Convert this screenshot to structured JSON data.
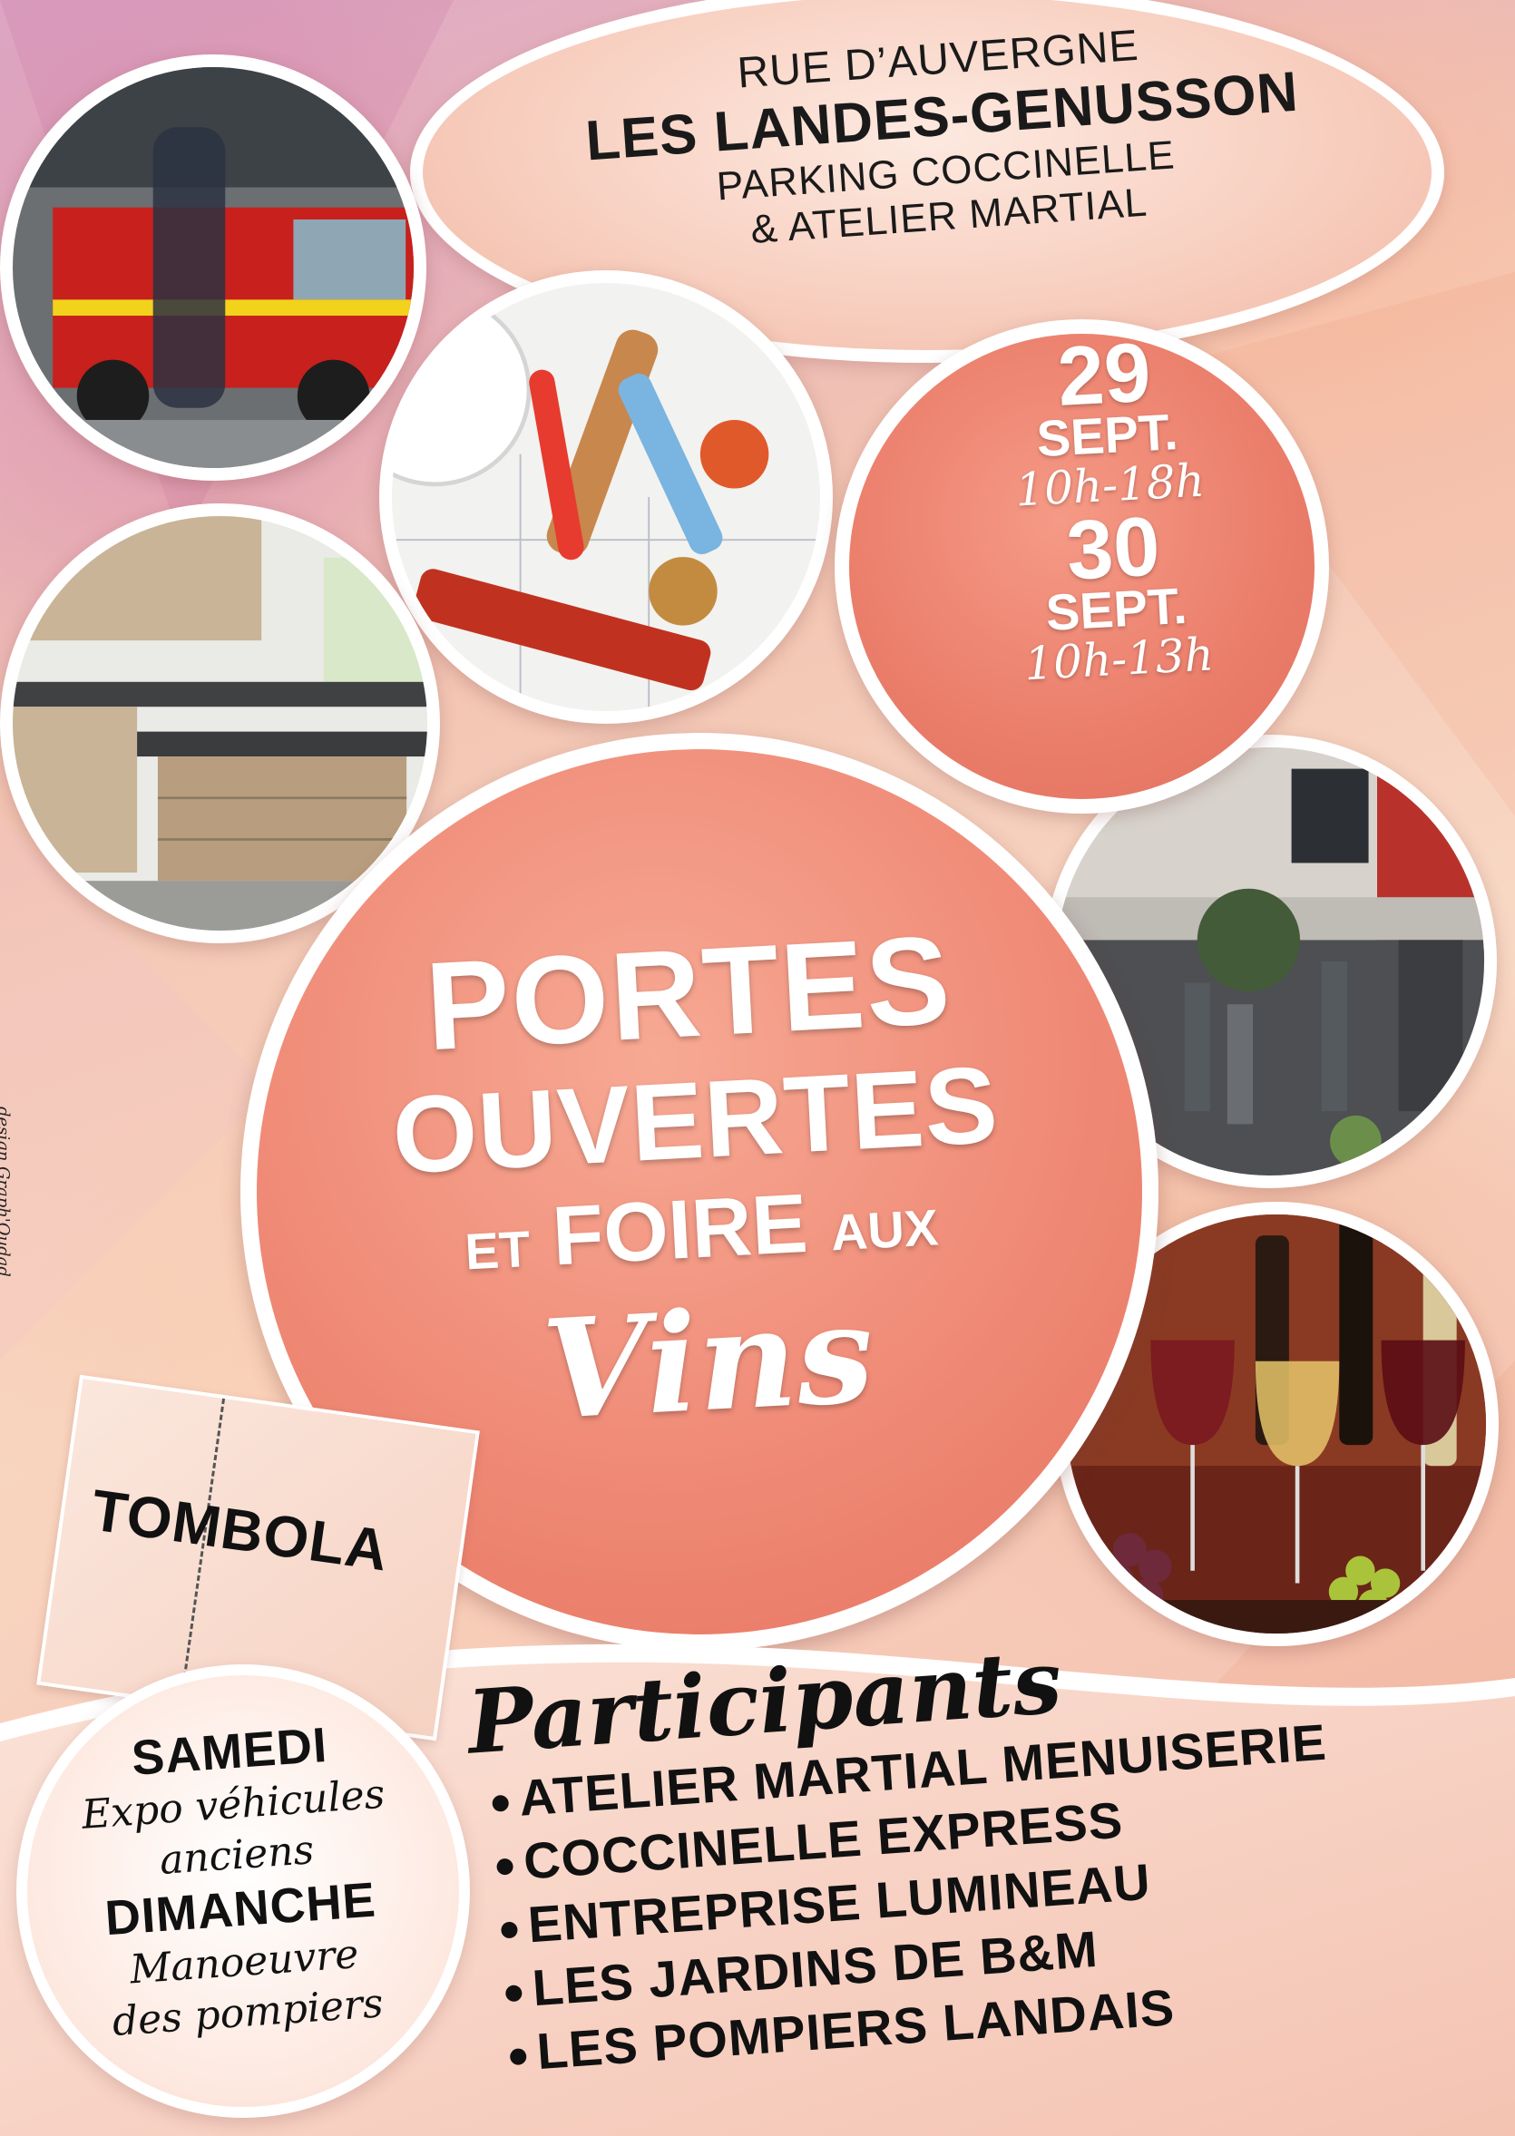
{
  "address": {
    "line1": "RUE D’AUVERGNE",
    "line2": "LES LANDES-GENUSSON",
    "line3": "PARKING COCCINELLE",
    "line4": "& ATELIER MARTIAL"
  },
  "dates": [
    {
      "day": "29",
      "month": "SEPT.",
      "hours": "10h-18h"
    },
    {
      "day": "30",
      "month": "SEPT.",
      "hours": "10h-13h"
    }
  ],
  "headline": {
    "line1": "PORTES",
    "line2": "OUVERTES",
    "line3_a": "ET",
    "line3_b": "FOIRE",
    "line3_c": "AUX",
    "line4": "Vins"
  },
  "tombola": "TOMBOLA",
  "program": {
    "day1": "SAMEDI",
    "day1_desc_a": "Expo véhicules",
    "day1_desc_b": "anciens",
    "day2": "DIMANCHE",
    "day2_desc_a": "Manoeuvre",
    "day2_desc_b": "des pompiers"
  },
  "participants": {
    "title": "Participants",
    "items": [
      "ATELIER MARTIAL MENUISERIE",
      "COCCINELLE EXPRESS",
      "ENTREPRISE LUMINEAU",
      "LES JARDINS DE B&M",
      "LES POMPIERS LANDAIS"
    ]
  },
  "credit": "design Graph'Oudad",
  "photos": [
    "fire-truck-photo",
    "plumbing-tools-photo",
    "kitchen-photo",
    "garden-photo",
    "wine-glasses-photo"
  ],
  "colors": {
    "accent": "#ea7d6a",
    "text": "#111111",
    "white": "#ffffff"
  }
}
